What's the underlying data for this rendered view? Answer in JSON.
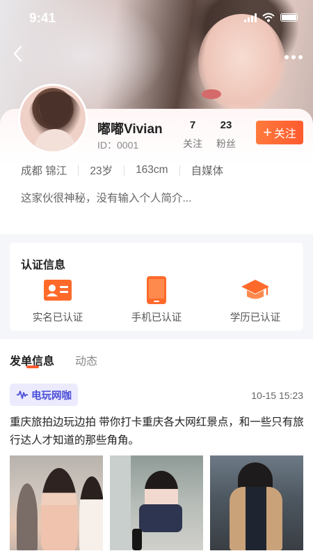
{
  "status_bar": {
    "time": "9:41"
  },
  "profile": {
    "name": "嘟嘟Vivian",
    "id_label": "ID：0001",
    "following_count": "7",
    "following_label": "关注",
    "fans_count": "23",
    "fans_label": "粉丝",
    "follow_button": "关注",
    "info": [
      "成都 锦江",
      "23岁",
      "163cm",
      "自媒体"
    ],
    "bio": "这家伙很神秘，没有输入个人简介..."
  },
  "certification": {
    "title": "认证信息",
    "items": [
      {
        "label": "实名已认证",
        "icon": "id-card-icon"
      },
      {
        "label": "手机已认证",
        "icon": "phone-icon"
      },
      {
        "label": "学历已认证",
        "icon": "graduation-cap-icon"
      }
    ]
  },
  "tabs": [
    {
      "label": "发单信息",
      "active": true
    },
    {
      "label": "动态",
      "active": false
    }
  ],
  "post": {
    "category": "电玩网咖",
    "time": "10-15 15:23",
    "text": "重庆旅拍边玩边拍 带你打卡重庆各大网红景点，和一些只有旅行达人才知道的那些角角。",
    "photos": [
      "photo-1",
      "photo-2",
      "photo-3"
    ]
  },
  "colors": {
    "accent": "#ff5a2e",
    "cert_orange": "#ff6a2a",
    "badge_bg": "#eceafd",
    "badge_text": "#4b4fd9"
  }
}
